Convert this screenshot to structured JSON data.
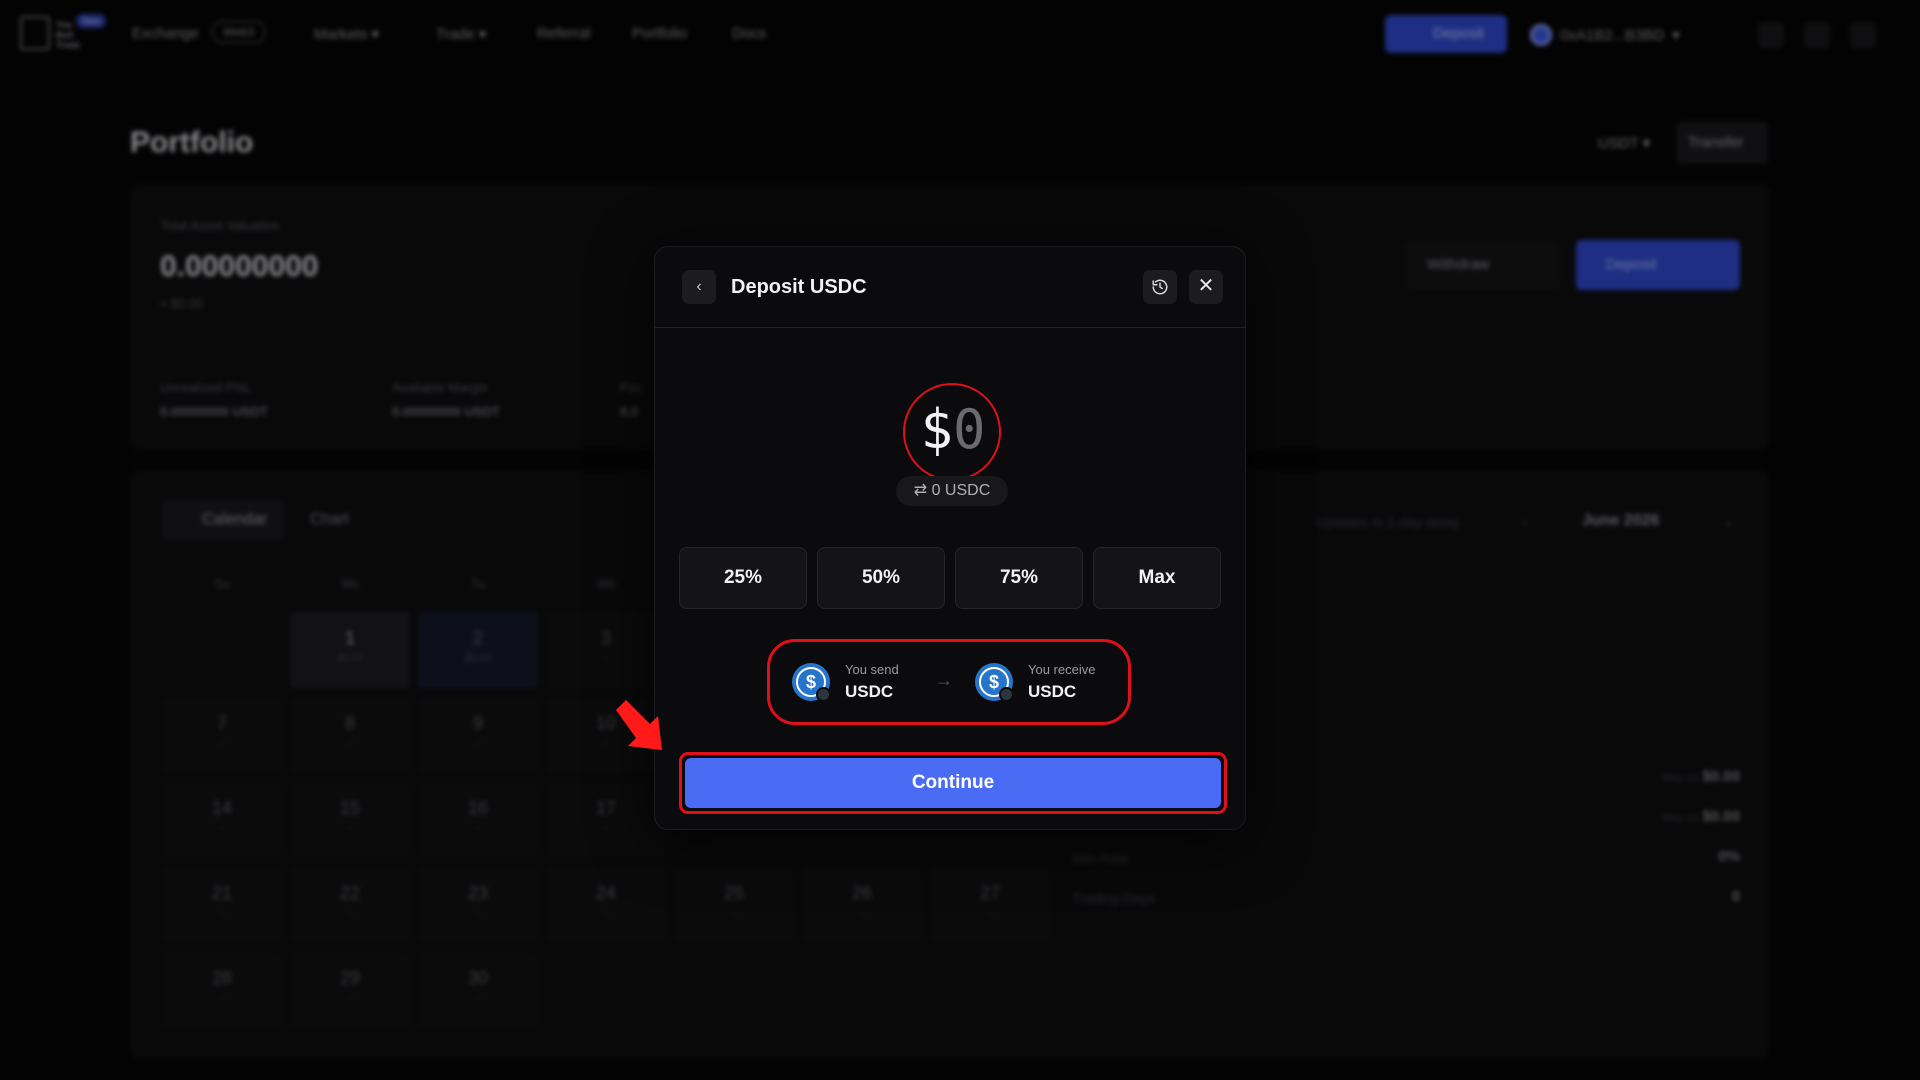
{
  "topbar": {
    "logo_lines": [
      "The",
      "Bull",
      "Trade"
    ],
    "logo_badge": "New",
    "exchange": "Exchange",
    "web3": "Web3",
    "nav": [
      "Markets",
      "Trade",
      "Referral",
      "Portfolio",
      "Docs"
    ],
    "deposit": "Deposit",
    "wallet": "0xA1B2...B3BD"
  },
  "page": {
    "title": "Portfolio",
    "currency": "USDT",
    "transfer": "Transfer"
  },
  "asset": {
    "label": "Total Asset Valuation",
    "value": "0.00000000",
    "usd": "≈ $0.00",
    "withdraw": "Withdraw",
    "deposit": "Deposit",
    "stats": [
      {
        "label": "Unrealized PNL",
        "value": "0.00000000 USDT"
      },
      {
        "label": "Available Margin",
        "value": "0.00000000 USDT"
      },
      {
        "label": "Pos",
        "value": "0.0"
      }
    ]
  },
  "calendar": {
    "tab_calendar": "Calendar",
    "tab_chart": "Chart",
    "delay_note": "Updates in 1-day delay",
    "month": "June 2026",
    "weekdays": [
      "Su",
      "Mo",
      "Tu",
      "We"
    ],
    "days": [
      {
        "n": "1",
        "s": "$0.00"
      },
      {
        "n": "2",
        "s": "$0.00"
      },
      {
        "n": "3",
        "s": "--"
      },
      {
        "n": "7",
        "s": "--"
      },
      {
        "n": "8",
        "s": "--"
      },
      {
        "n": "9",
        "s": "--"
      },
      {
        "n": "10",
        "s": "--"
      },
      {
        "n": "14",
        "s": "--"
      },
      {
        "n": "15",
        "s": "--"
      },
      {
        "n": "16",
        "s": "--"
      },
      {
        "n": "17",
        "s": "--"
      },
      {
        "n": "21",
        "s": "--"
      },
      {
        "n": "22",
        "s": "--"
      },
      {
        "n": "23",
        "s": "--"
      },
      {
        "n": "24",
        "s": "--"
      },
      {
        "n": "25",
        "s": "--"
      },
      {
        "n": "26",
        "s": "--"
      },
      {
        "n": "27",
        "s": "--"
      },
      {
        "n": "28",
        "s": "--"
      },
      {
        "n": "29",
        "s": "--"
      },
      {
        "n": "30",
        "s": "--"
      }
    ],
    "side_stats": [
      {
        "label": "",
        "date": "May 31",
        "value": "$0.00"
      },
      {
        "label": "",
        "date": "May 31",
        "value": "$0.00"
      },
      {
        "label": "Win Rate",
        "date": "",
        "value": "0%"
      },
      {
        "label": "Trading Days",
        "date": "",
        "value": "0"
      }
    ]
  },
  "modal": {
    "title": "Deposit USDC",
    "amount_currency": "$",
    "amount_value": "0",
    "converted": "0 USDC",
    "percent_buttons": [
      "25%",
      "50%",
      "75%",
      "Max"
    ],
    "send_label": "You send",
    "send_token": "USDC",
    "receive_label": "You receive",
    "receive_token": "USDC",
    "continue": "Continue"
  },
  "colors": {
    "accent": "#4a6cf4",
    "highlight": "#e0101a",
    "usdc": "#2775ca"
  }
}
